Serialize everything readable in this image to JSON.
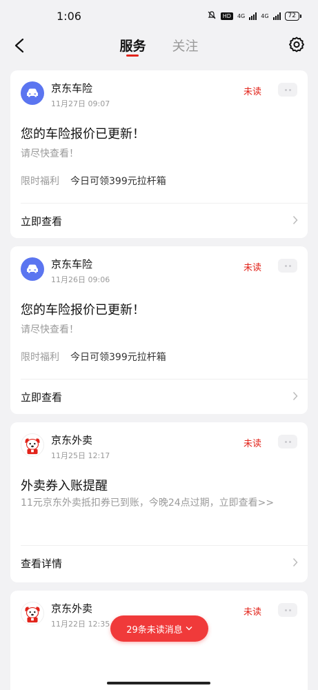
{
  "status_bar": {
    "time": "1:06",
    "network1": "4G",
    "network2": "4G",
    "hd": "HD",
    "battery": "72"
  },
  "nav": {
    "tabs": [
      {
        "label": "服务",
        "active": true
      },
      {
        "label": "关注",
        "active": false
      }
    ]
  },
  "messages": [
    {
      "sender": "京东车险",
      "time": "11月27日 09:07",
      "status": "未读",
      "title": "您的车险报价已更新！",
      "subtitle": "请尽快查看！",
      "benefit_label": "限时福利",
      "benefit_value": "今日可领399元拉杆箱",
      "action": "立即查看",
      "avatar_icon": "car-icon"
    },
    {
      "sender": "京东车险",
      "time": "11月26日 09:06",
      "status": "未读",
      "title": "您的车险报价已更新！",
      "subtitle": "请尽快查看！",
      "benefit_label": "限时福利",
      "benefit_value": "今日可领399元拉杆箱",
      "action": "立即查看",
      "avatar_icon": "car-icon"
    },
    {
      "sender": "京东外卖",
      "time": "11月25日 12:17",
      "status": "未读",
      "title": "外卖券入账提醒",
      "subtitle": "11元京东外卖抵扣券已到账，今晚24点过期，立即查看>>",
      "action": "查看详情",
      "avatar_icon": "jd-dog-icon"
    },
    {
      "sender": "京东外卖",
      "time": "11月22日 12:35",
      "status": "未读",
      "avatar_icon": "jd-dog-icon"
    }
  ],
  "unread_pill": {
    "label": "29条未读消息"
  },
  "colors": {
    "accent": "#e2231a",
    "background": "#f2f2f4",
    "card": "#ffffff",
    "car_avatar": "#5b75f0"
  }
}
